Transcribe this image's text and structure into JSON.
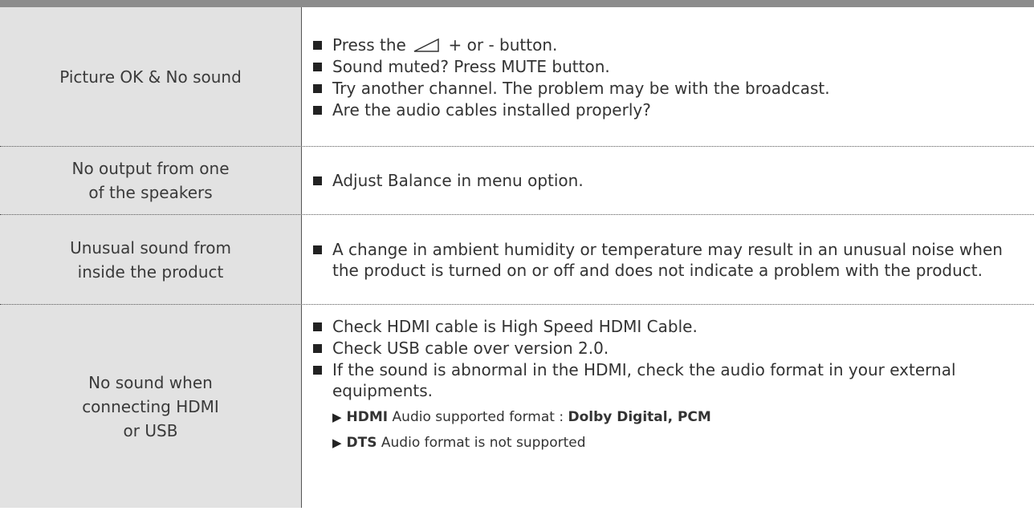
{
  "rows": [
    {
      "label": "Picture OK & No sound",
      "bullets": [
        {
          "before": "Press the",
          "after": "+ or - button.",
          "icon": "volume-icon"
        },
        {
          "text": "Sound muted? Press MUTE button."
        },
        {
          "text": "Try another channel. The problem may be with the broadcast."
        },
        {
          "text": "Are the audio cables installed properly?"
        }
      ]
    },
    {
      "label": "No output from one\nof the speakers",
      "bullets": [
        {
          "text": "Adjust Balance in menu option."
        }
      ]
    },
    {
      "label": "Unusual sound from\ninside the product",
      "bullets": [
        {
          "text": "A change in ambient humidity or temperature may result in an unusual noise when the product is turned on or off and does not indicate a problem with the product."
        }
      ]
    },
    {
      "label": "No sound when\nconnecting HDMI\nor USB",
      "bullets": [
        {
          "text": "Check HDMI cable is High Speed HDMI Cable."
        },
        {
          "text": "Check USB cable over version 2.0."
        },
        {
          "text": "If the sound is abnormal in the HDMI, check the audio format in your external equipments."
        }
      ],
      "subitems": [
        {
          "arrow": "▶",
          "bold1": "HDMI",
          "mid": "Audio supported format :",
          "bold2": "Dolby Digital, PCM"
        },
        {
          "arrow": "▶",
          "bold1": "DTS",
          "mid": "Audio format is not supported"
        }
      ]
    }
  ],
  "colors": {
    "topbar": "#8c8c8c",
    "label_column": "#e2e2e2",
    "text": "#333333"
  }
}
